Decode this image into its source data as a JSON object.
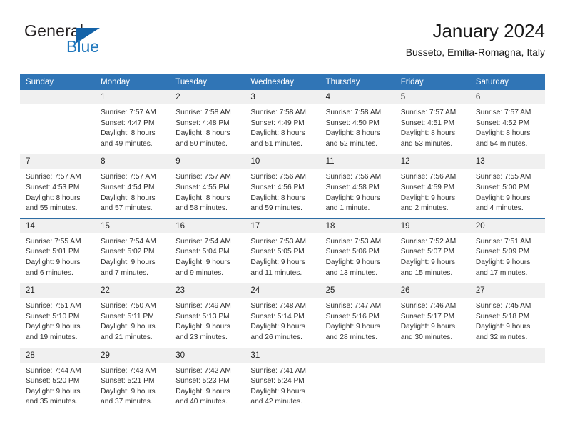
{
  "brand": {
    "name_part1": "General",
    "name_part2": "Blue",
    "accent_color": "#1362a8",
    "text_color": "#231f20"
  },
  "header": {
    "title": "January 2024",
    "subtitle": "Busseto, Emilia-Romagna, Italy"
  },
  "theme": {
    "header_blue": "#3075b6",
    "row_divider_blue": "#2e6da4",
    "daynum_band": "#f0f0f0"
  },
  "weekday_headers": [
    "Sunday",
    "Monday",
    "Tuesday",
    "Wednesday",
    "Thursday",
    "Friday",
    "Saturday"
  ],
  "weeks": [
    [
      {
        "day": "",
        "sunrise": "",
        "sunset": "",
        "daylight_line1": "",
        "daylight_line2": ""
      },
      {
        "day": "1",
        "sunrise": "Sunrise: 7:57 AM",
        "sunset": "Sunset: 4:47 PM",
        "daylight_line1": "Daylight: 8 hours",
        "daylight_line2": "and 49 minutes."
      },
      {
        "day": "2",
        "sunrise": "Sunrise: 7:58 AM",
        "sunset": "Sunset: 4:48 PM",
        "daylight_line1": "Daylight: 8 hours",
        "daylight_line2": "and 50 minutes."
      },
      {
        "day": "3",
        "sunrise": "Sunrise: 7:58 AM",
        "sunset": "Sunset: 4:49 PM",
        "daylight_line1": "Daylight: 8 hours",
        "daylight_line2": "and 51 minutes."
      },
      {
        "day": "4",
        "sunrise": "Sunrise: 7:58 AM",
        "sunset": "Sunset: 4:50 PM",
        "daylight_line1": "Daylight: 8 hours",
        "daylight_line2": "and 52 minutes."
      },
      {
        "day": "5",
        "sunrise": "Sunrise: 7:57 AM",
        "sunset": "Sunset: 4:51 PM",
        "daylight_line1": "Daylight: 8 hours",
        "daylight_line2": "and 53 minutes."
      },
      {
        "day": "6",
        "sunrise": "Sunrise: 7:57 AM",
        "sunset": "Sunset: 4:52 PM",
        "daylight_line1": "Daylight: 8 hours",
        "daylight_line2": "and 54 minutes."
      }
    ],
    [
      {
        "day": "7",
        "sunrise": "Sunrise: 7:57 AM",
        "sunset": "Sunset: 4:53 PM",
        "daylight_line1": "Daylight: 8 hours",
        "daylight_line2": "and 55 minutes."
      },
      {
        "day": "8",
        "sunrise": "Sunrise: 7:57 AM",
        "sunset": "Sunset: 4:54 PM",
        "daylight_line1": "Daylight: 8 hours",
        "daylight_line2": "and 57 minutes."
      },
      {
        "day": "9",
        "sunrise": "Sunrise: 7:57 AM",
        "sunset": "Sunset: 4:55 PM",
        "daylight_line1": "Daylight: 8 hours",
        "daylight_line2": "and 58 minutes."
      },
      {
        "day": "10",
        "sunrise": "Sunrise: 7:56 AM",
        "sunset": "Sunset: 4:56 PM",
        "daylight_line1": "Daylight: 8 hours",
        "daylight_line2": "and 59 minutes."
      },
      {
        "day": "11",
        "sunrise": "Sunrise: 7:56 AM",
        "sunset": "Sunset: 4:58 PM",
        "daylight_line1": "Daylight: 9 hours",
        "daylight_line2": "and 1 minute."
      },
      {
        "day": "12",
        "sunrise": "Sunrise: 7:56 AM",
        "sunset": "Sunset: 4:59 PM",
        "daylight_line1": "Daylight: 9 hours",
        "daylight_line2": "and 2 minutes."
      },
      {
        "day": "13",
        "sunrise": "Sunrise: 7:55 AM",
        "sunset": "Sunset: 5:00 PM",
        "daylight_line1": "Daylight: 9 hours",
        "daylight_line2": "and 4 minutes."
      }
    ],
    [
      {
        "day": "14",
        "sunrise": "Sunrise: 7:55 AM",
        "sunset": "Sunset: 5:01 PM",
        "daylight_line1": "Daylight: 9 hours",
        "daylight_line2": "and 6 minutes."
      },
      {
        "day": "15",
        "sunrise": "Sunrise: 7:54 AM",
        "sunset": "Sunset: 5:02 PM",
        "daylight_line1": "Daylight: 9 hours",
        "daylight_line2": "and 7 minutes."
      },
      {
        "day": "16",
        "sunrise": "Sunrise: 7:54 AM",
        "sunset": "Sunset: 5:04 PM",
        "daylight_line1": "Daylight: 9 hours",
        "daylight_line2": "and 9 minutes."
      },
      {
        "day": "17",
        "sunrise": "Sunrise: 7:53 AM",
        "sunset": "Sunset: 5:05 PM",
        "daylight_line1": "Daylight: 9 hours",
        "daylight_line2": "and 11 minutes."
      },
      {
        "day": "18",
        "sunrise": "Sunrise: 7:53 AM",
        "sunset": "Sunset: 5:06 PM",
        "daylight_line1": "Daylight: 9 hours",
        "daylight_line2": "and 13 minutes."
      },
      {
        "day": "19",
        "sunrise": "Sunrise: 7:52 AM",
        "sunset": "Sunset: 5:07 PM",
        "daylight_line1": "Daylight: 9 hours",
        "daylight_line2": "and 15 minutes."
      },
      {
        "day": "20",
        "sunrise": "Sunrise: 7:51 AM",
        "sunset": "Sunset: 5:09 PM",
        "daylight_line1": "Daylight: 9 hours",
        "daylight_line2": "and 17 minutes."
      }
    ],
    [
      {
        "day": "21",
        "sunrise": "Sunrise: 7:51 AM",
        "sunset": "Sunset: 5:10 PM",
        "daylight_line1": "Daylight: 9 hours",
        "daylight_line2": "and 19 minutes."
      },
      {
        "day": "22",
        "sunrise": "Sunrise: 7:50 AM",
        "sunset": "Sunset: 5:11 PM",
        "daylight_line1": "Daylight: 9 hours",
        "daylight_line2": "and 21 minutes."
      },
      {
        "day": "23",
        "sunrise": "Sunrise: 7:49 AM",
        "sunset": "Sunset: 5:13 PM",
        "daylight_line1": "Daylight: 9 hours",
        "daylight_line2": "and 23 minutes."
      },
      {
        "day": "24",
        "sunrise": "Sunrise: 7:48 AM",
        "sunset": "Sunset: 5:14 PM",
        "daylight_line1": "Daylight: 9 hours",
        "daylight_line2": "and 26 minutes."
      },
      {
        "day": "25",
        "sunrise": "Sunrise: 7:47 AM",
        "sunset": "Sunset: 5:16 PM",
        "daylight_line1": "Daylight: 9 hours",
        "daylight_line2": "and 28 minutes."
      },
      {
        "day": "26",
        "sunrise": "Sunrise: 7:46 AM",
        "sunset": "Sunset: 5:17 PM",
        "daylight_line1": "Daylight: 9 hours",
        "daylight_line2": "and 30 minutes."
      },
      {
        "day": "27",
        "sunrise": "Sunrise: 7:45 AM",
        "sunset": "Sunset: 5:18 PM",
        "daylight_line1": "Daylight: 9 hours",
        "daylight_line2": "and 32 minutes."
      }
    ],
    [
      {
        "day": "28",
        "sunrise": "Sunrise: 7:44 AM",
        "sunset": "Sunset: 5:20 PM",
        "daylight_line1": "Daylight: 9 hours",
        "daylight_line2": "and 35 minutes."
      },
      {
        "day": "29",
        "sunrise": "Sunrise: 7:43 AM",
        "sunset": "Sunset: 5:21 PM",
        "daylight_line1": "Daylight: 9 hours",
        "daylight_line2": "and 37 minutes."
      },
      {
        "day": "30",
        "sunrise": "Sunrise: 7:42 AM",
        "sunset": "Sunset: 5:23 PM",
        "daylight_line1": "Daylight: 9 hours",
        "daylight_line2": "and 40 minutes."
      },
      {
        "day": "31",
        "sunrise": "Sunrise: 7:41 AM",
        "sunset": "Sunset: 5:24 PM",
        "daylight_line1": "Daylight: 9 hours",
        "daylight_line2": "and 42 minutes."
      },
      {
        "day": "",
        "sunrise": "",
        "sunset": "",
        "daylight_line1": "",
        "daylight_line2": ""
      },
      {
        "day": "",
        "sunrise": "",
        "sunset": "",
        "daylight_line1": "",
        "daylight_line2": ""
      },
      {
        "day": "",
        "sunrise": "",
        "sunset": "",
        "daylight_line1": "",
        "daylight_line2": ""
      }
    ]
  ]
}
